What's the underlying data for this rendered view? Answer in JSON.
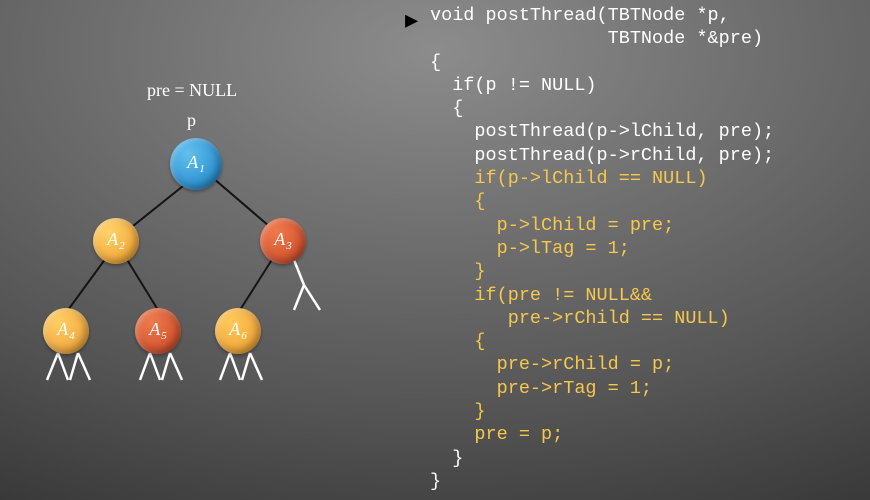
{
  "diagram": {
    "pre_label": "pre = NULL",
    "p_label": "p",
    "nodes": {
      "a1": {
        "letter": "A",
        "sub": "1"
      },
      "a2": {
        "letter": "A",
        "sub": "2"
      },
      "a3": {
        "letter": "A",
        "sub": "3"
      },
      "a4": {
        "letter": "A",
        "sub": "4"
      },
      "a5": {
        "letter": "A",
        "sub": "5"
      },
      "a6": {
        "letter": "A",
        "sub": "6"
      }
    }
  },
  "code": {
    "l1": "void postThread(TBTNode *p,",
    "l2": "                TBTNode *&pre)",
    "l3": "{",
    "l4": "  if(p != NULL)",
    "l5": "  {",
    "l6": "    postThread(p->lChild, pre);",
    "l7": "    postThread(p->rChild, pre);",
    "l8": "    if(p->lChild == NULL)",
    "l9": "    {",
    "l10": "      p->lChild = pre;",
    "l11": "      p->lTag = 1;",
    "l12": "    }",
    "l13": "    if(pre != NULL&&",
    "l14": "       pre->rChild == NULL)",
    "l15": "    {",
    "l16": "      pre->rChild = p;",
    "l17": "      pre->rTag = 1;",
    "l18": "    }",
    "l19": "    pre = p;",
    "l20": "  }",
    "l21": "}"
  },
  "cursor_glyph": "▶"
}
